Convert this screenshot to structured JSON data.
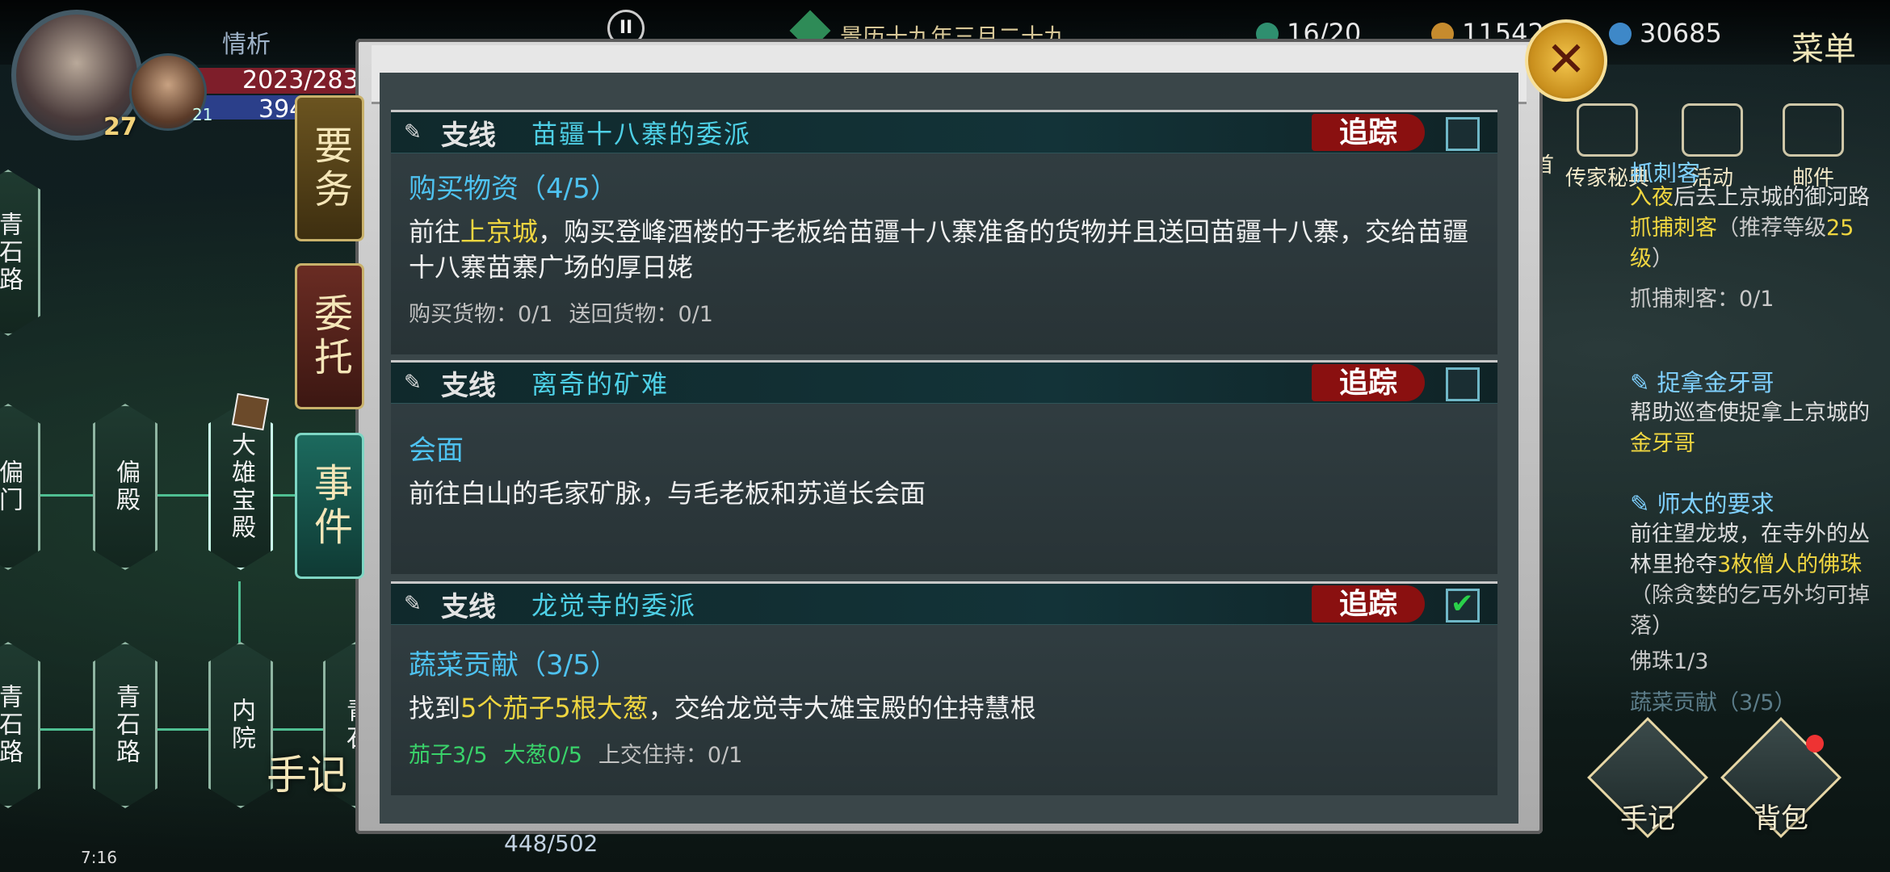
{
  "hud": {
    "player_name": "情析",
    "hp_text": "2023/283",
    "mp_text": "394",
    "level": "27",
    "companion_level": "21",
    "pause_label": "II",
    "date": "景历十九年三月二十九",
    "stamina": "16/20",
    "gold": "11542",
    "spirit": "30685",
    "menu": "菜单"
  },
  "right_menu": [
    "传家秘典",
    "活动",
    "邮件"
  ],
  "right_menu_partial": "首",
  "right_quests": [
    {
      "title": "抓刺客",
      "lines": [
        {
          "t": "入夜",
          "c": "y"
        },
        {
          "t": "后去上京城的御河路",
          "c": ""
        },
        {
          "t": "抓捕刺客",
          "c": "y"
        },
        {
          "t": "（推荐等级",
          "c": "gry"
        },
        {
          "t": "25级",
          "c": "y"
        },
        {
          "t": "）",
          "c": "gry"
        }
      ],
      "progress": "抓捕刺客：0/1"
    },
    {
      "title": "捉拿金牙哥",
      "lines": [
        {
          "t": "帮助巡查使捉拿上京城的",
          "c": ""
        },
        {
          "t": "金牙哥",
          "c": "y"
        }
      ],
      "progress": ""
    },
    {
      "title": "师太的要求",
      "lines": [
        {
          "t": "前往望龙坡，在寺外的丛林里抢夺",
          "c": ""
        },
        {
          "t": "3枚僧人的佛珠",
          "c": "y"
        },
        {
          "t": "（除贪婪的乞丐外均可掉落）",
          "c": "gry"
        }
      ],
      "progress": "佛珠1/3"
    },
    {
      "title": "蔬菜贡献（3/5）",
      "lines": [],
      "progress": ""
    }
  ],
  "map_nodes": [
    "青石路",
    "偏门",
    "偏殿",
    "大雄宝殿",
    "青石路",
    "青石路",
    "内院",
    "青石"
  ],
  "tabs": [
    "要务",
    "委托",
    "事件"
  ],
  "bottom_left_label": "手记",
  "bottom_right": [
    "手记",
    "背包"
  ],
  "bottom_stat": "448/502",
  "status_time": "7:16",
  "panel": {
    "close_label": "✕",
    "quests": [
      {
        "kind": "支线",
        "name": "苗疆十八寨的委派",
        "track_label": "追踪",
        "tracked": false,
        "step": "购买物资（4/5）",
        "desc": [
          {
            "t": "前往",
            "c": ""
          },
          {
            "t": "上京城",
            "c": "y"
          },
          {
            "t": "，购买登峰酒楼的于老板给苗疆十八寨准备的货物并且送回苗疆十八寨，交给苗疆十八寨苗寨广场的厚日姥",
            "c": ""
          }
        ],
        "progress": [
          {
            "t": "购买货物：0/1",
            "c": ""
          },
          {
            "t": "送回货物：0/1",
            "c": ""
          }
        ]
      },
      {
        "kind": "支线",
        "name": "离奇的矿难",
        "track_label": "追踪",
        "tracked": false,
        "step": "会面",
        "desc": [
          {
            "t": "前往白山的毛家矿脉，与毛老板和苏道长会面",
            "c": ""
          }
        ],
        "progress": []
      },
      {
        "kind": "支线",
        "name": "龙觉寺的委派",
        "track_label": "追踪",
        "tracked": true,
        "step": "蔬菜贡献（3/5）",
        "desc": [
          {
            "t": "找到",
            "c": ""
          },
          {
            "t": "5个茄子5根大葱",
            "c": "y"
          },
          {
            "t": "，交给龙觉寺大雄宝殿的住持慧根",
            "c": ""
          }
        ],
        "progress": [
          {
            "t": "茄子3/5",
            "c": "g"
          },
          {
            "t": "大葱0/5",
            "c": "g"
          },
          {
            "t": "上交住持：0/1",
            "c": ""
          }
        ]
      }
    ]
  }
}
